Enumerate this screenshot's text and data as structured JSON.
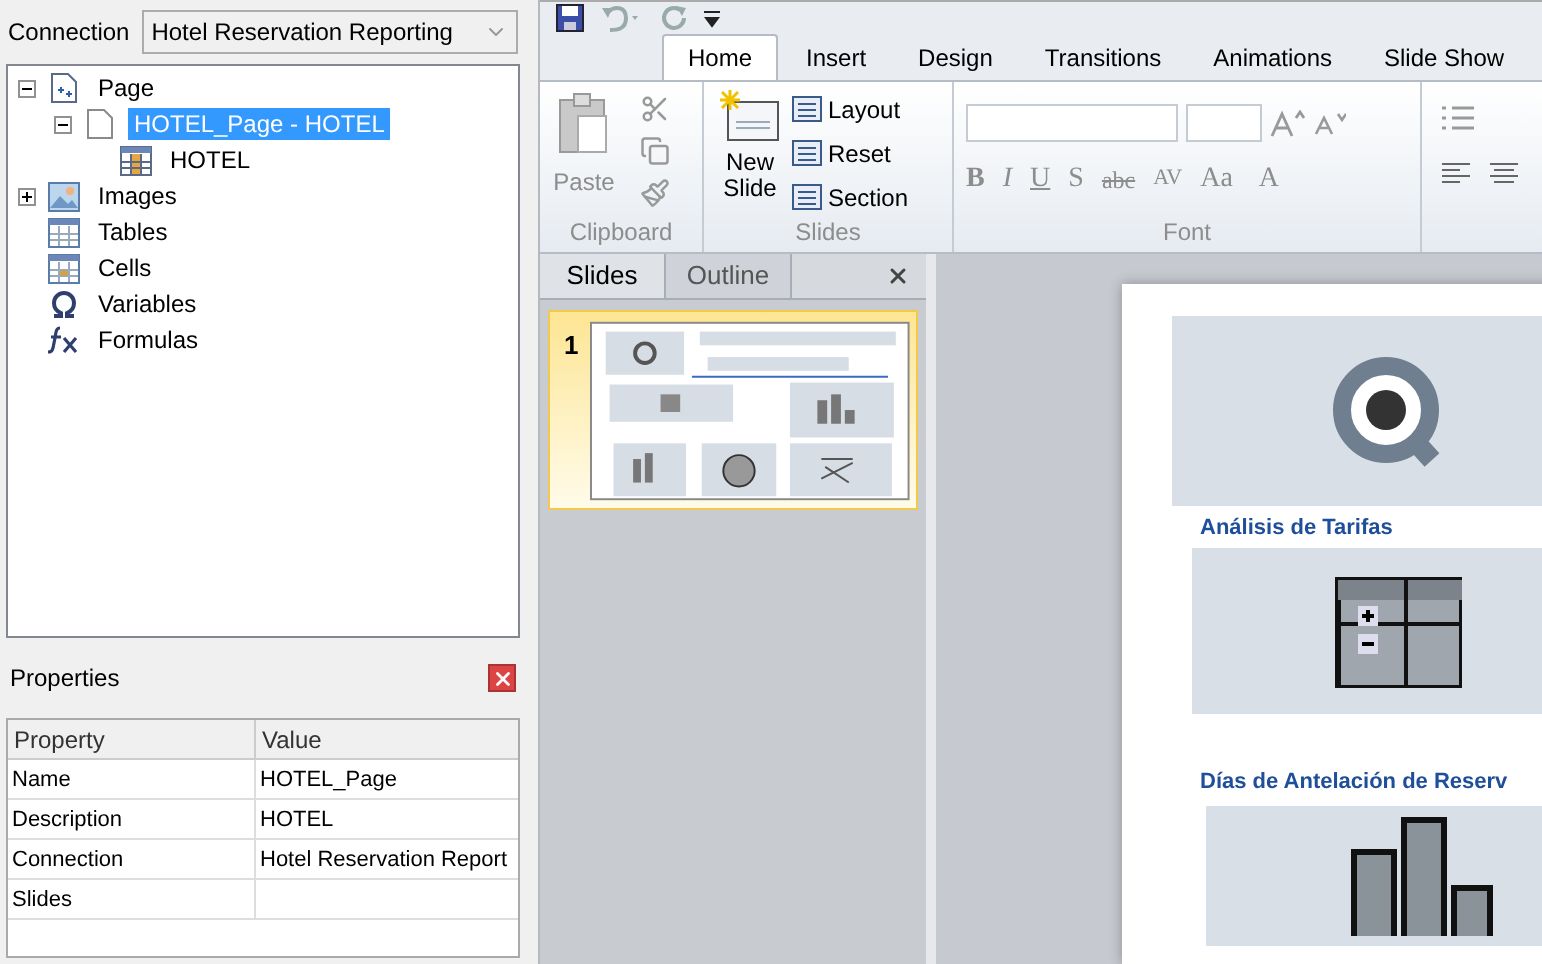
{
  "connection": {
    "label": "Connection",
    "value": "Hotel Reservation Reporting"
  },
  "tree": [
    {
      "label": "Page",
      "kind": "page",
      "expanded": true,
      "selected": false,
      "children": [
        {
          "label": "HOTEL_Page - HOTEL",
          "kind": "doc",
          "expanded": true,
          "selected": true,
          "children": [
            {
              "label": "HOTEL",
              "kind": "table",
              "selected": false
            }
          ]
        }
      ]
    },
    {
      "label": "Images",
      "kind": "images",
      "expanded": false,
      "selected": false
    },
    {
      "label": "Tables",
      "kind": "tables",
      "selected": false
    },
    {
      "label": "Cells",
      "kind": "cells",
      "selected": false
    },
    {
      "label": "Variables",
      "kind": "omega",
      "selected": false
    },
    {
      "label": "Formulas",
      "kind": "fx",
      "selected": false
    }
  ],
  "properties": {
    "title": "Properties",
    "columns": [
      "Property",
      "Value"
    ],
    "rows": [
      [
        "Name",
        "HOTEL_Page"
      ],
      [
        "Description",
        "HOTEL"
      ],
      [
        "Connection",
        "Hotel Reservation Report"
      ],
      [
        "Slides",
        ""
      ]
    ]
  },
  "ribbon": {
    "disabled": true,
    "tabs": [
      {
        "label": "Home",
        "selected": true
      },
      {
        "label": "Insert",
        "selected": false
      },
      {
        "label": "Design",
        "selected": false
      },
      {
        "label": "Transitions",
        "selected": false
      },
      {
        "label": "Animations",
        "selected": false
      },
      {
        "label": "Slide Show",
        "selected": false
      }
    ],
    "clipboard": {
      "title": "Clipboard",
      "paste": "Paste"
    },
    "slides": {
      "title": "Slides",
      "new_slide": [
        "New",
        "Slide"
      ],
      "layout": "Layout",
      "reset": "Reset",
      "section": "Section"
    },
    "font": {
      "title": "Font",
      "buttons": [
        "B",
        "I",
        "U",
        "S",
        "abc",
        "AV",
        "Aa"
      ],
      "text_color_label": "A"
    }
  },
  "slide_panel": {
    "tabs": [
      {
        "label": "Slides",
        "selected": true
      },
      {
        "label": "Outline",
        "selected": false
      }
    ],
    "thumbnails": [
      {
        "number": "1",
        "selected": true
      }
    ]
  },
  "slide": {
    "items": [
      {
        "kind": "image"
      },
      {
        "kind": "heading",
        "text": "Análisis de Tarifas"
      },
      {
        "kind": "image"
      },
      {
        "kind": "heading",
        "text": "Días de Antelación de Reserv"
      },
      {
        "kind": "image"
      }
    ]
  }
}
